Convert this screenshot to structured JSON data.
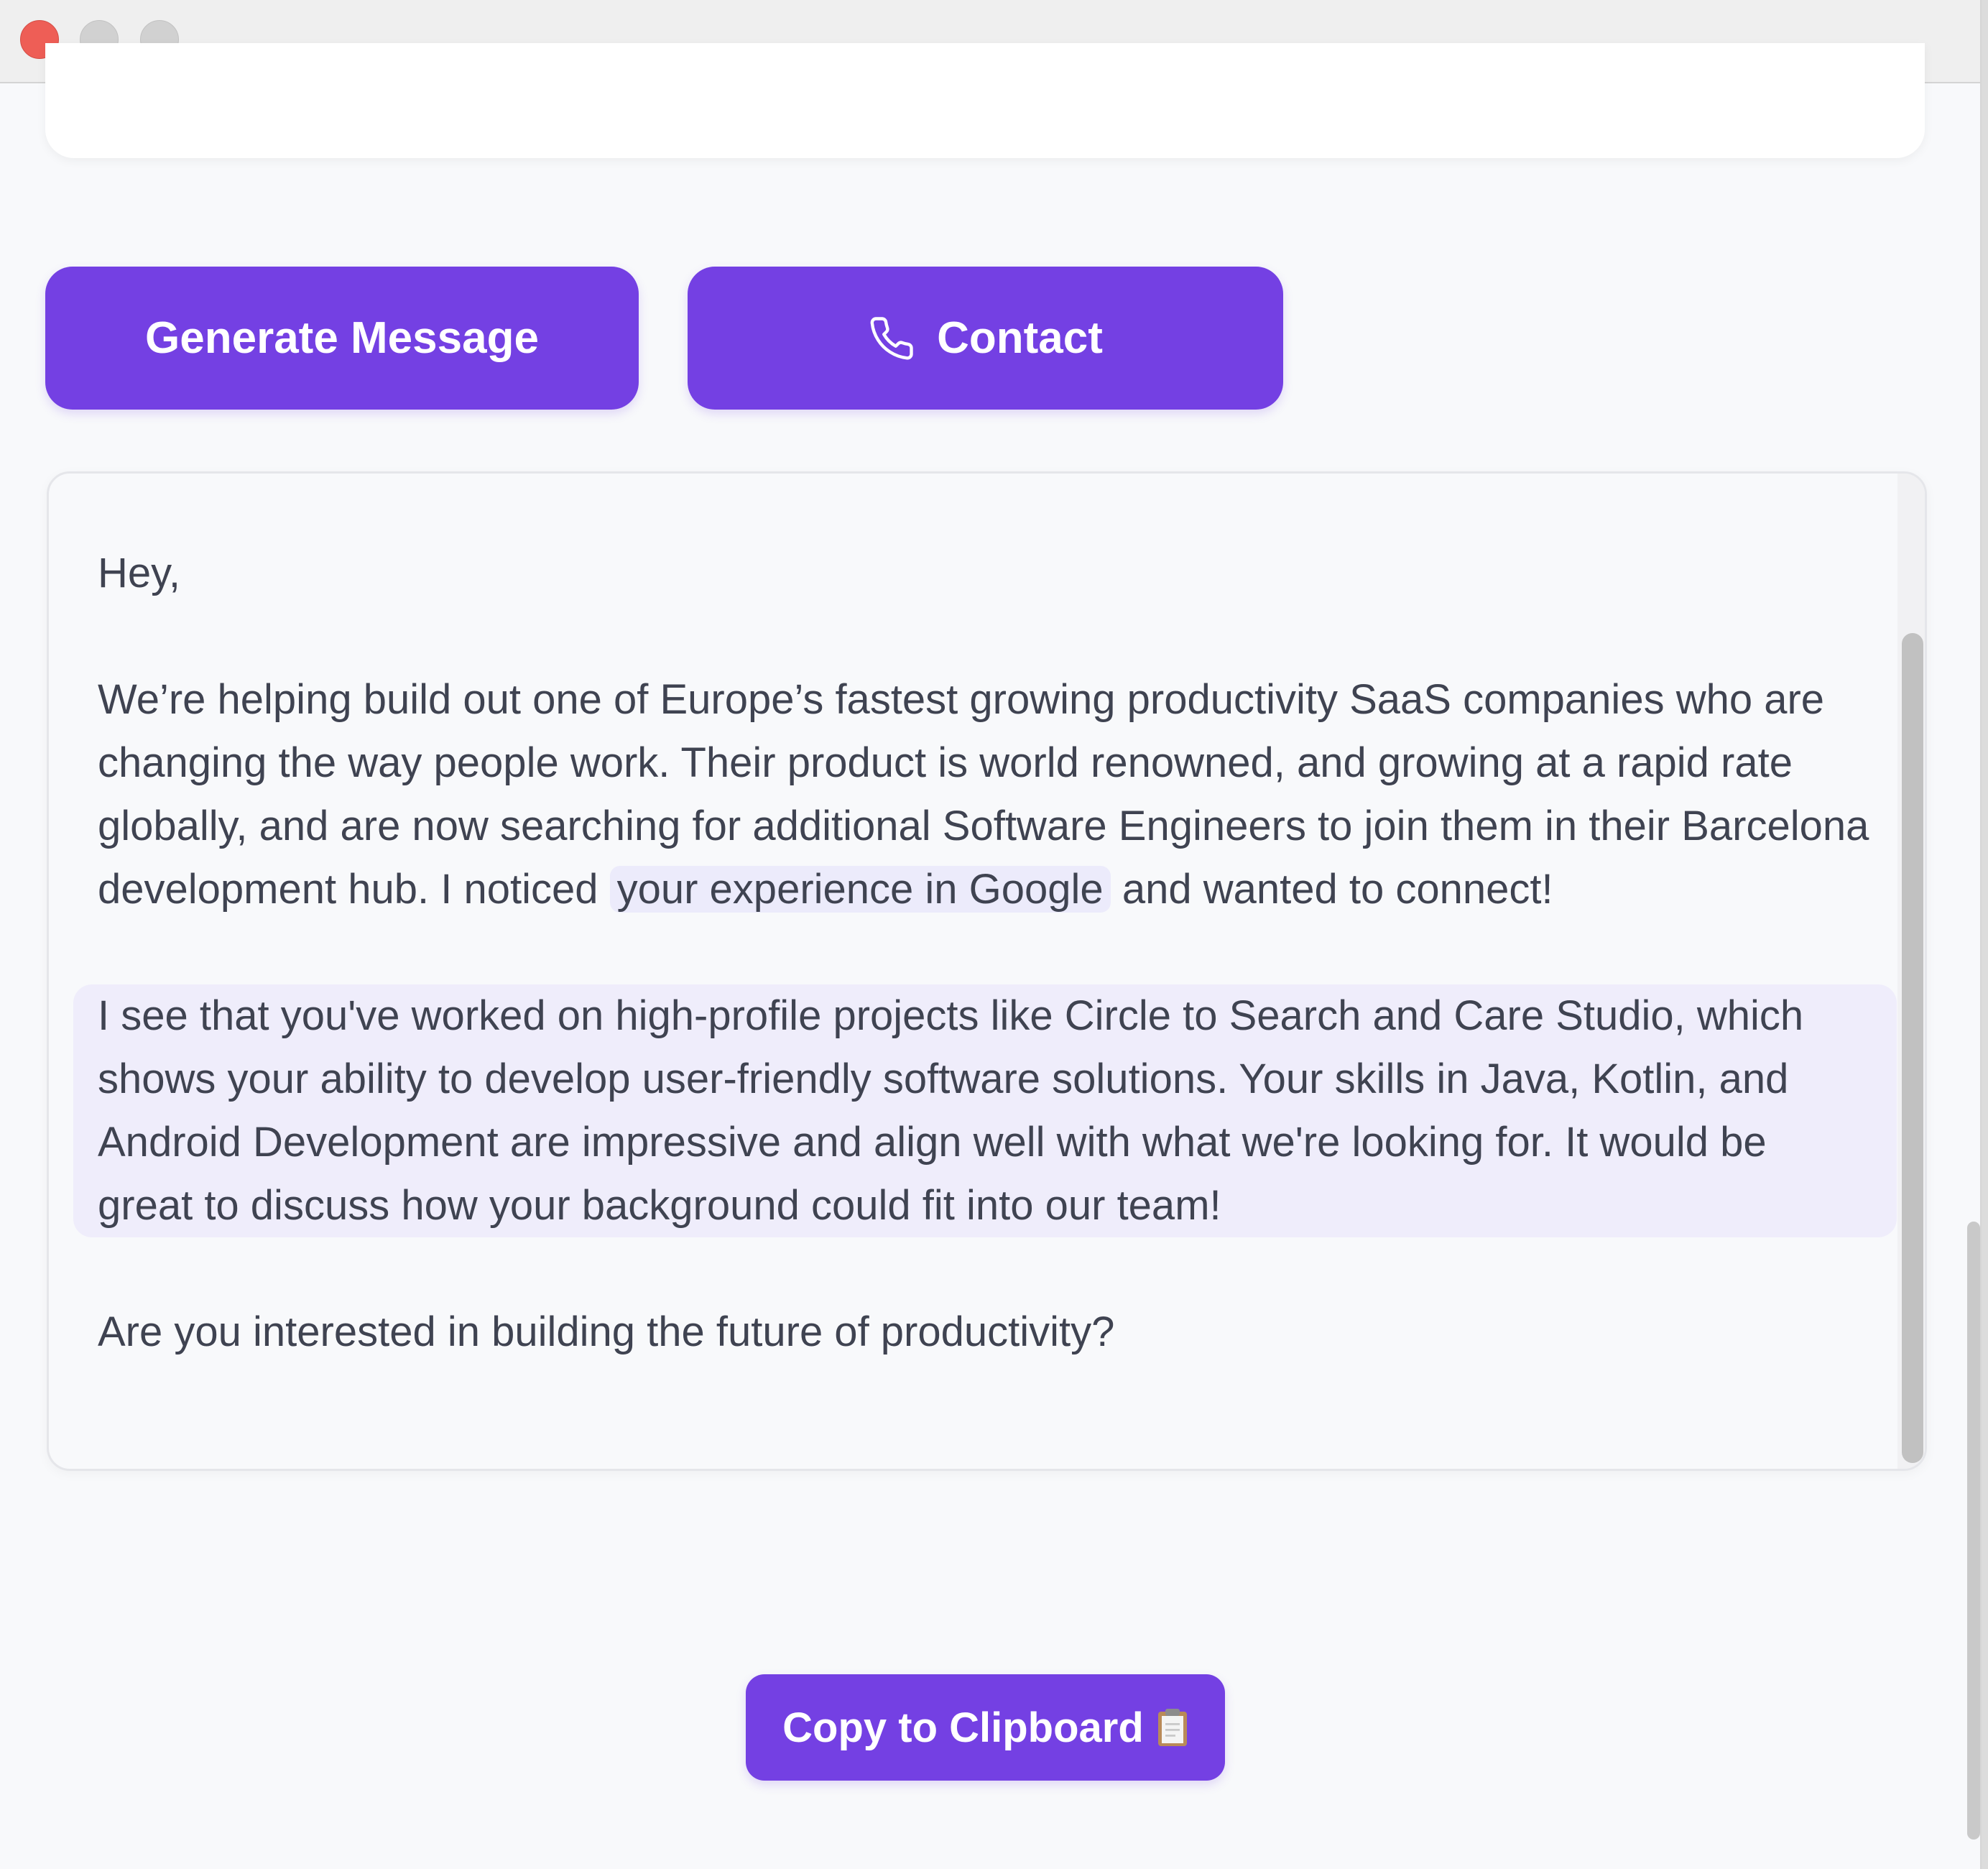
{
  "window": {
    "controls": [
      "close",
      "minimize",
      "maximize"
    ]
  },
  "actions": {
    "generate_label": "Generate Message",
    "contact_label": "Contact",
    "contact_icon": "phone-icon",
    "copy_label": "Copy to Clipboard",
    "copy_icon": "clipboard-icon"
  },
  "message": {
    "greeting": "Hey,",
    "intro_before": "We’re helping build out one of Europe’s fastest growing productivity SaaS companies who are changing the way people work. Their product is world renowned, and growing at a rapid rate globally, and are now searching for additional Software Engineers to join them in their Barcelona development hub. I noticed ",
    "intro_highlight": "your experience in Google",
    "intro_after": " and wanted to connect!",
    "personalized": "I see that you've worked on high-profile projects like Circle to Search and Care Studio, which shows your ability to develop user-friendly software solutions. Your skills in Java, Kotlin, and Android Development are impressive and align well with what we're looking for. It would be great to discuss how your background could fit into our team!",
    "closing": "Are you interested in building the future of productivity?"
  },
  "colors": {
    "accent": "#7440e3",
    "highlight": "#efedfb",
    "text": "#3f4351",
    "background": "#f8f9fb"
  }
}
